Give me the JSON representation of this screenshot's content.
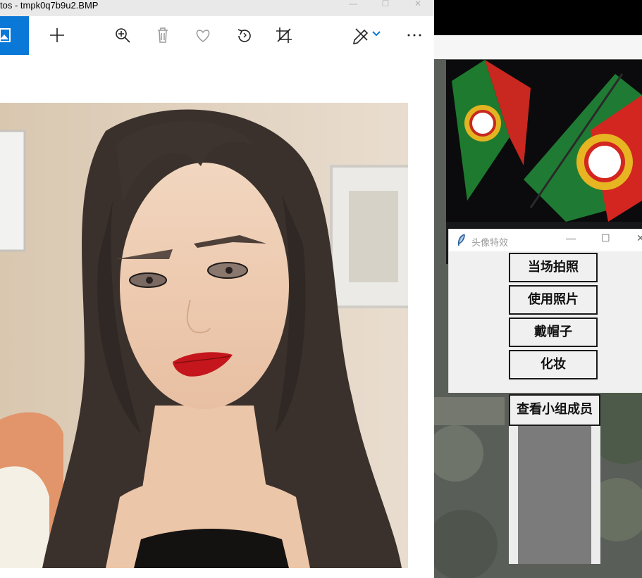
{
  "photos_window": {
    "title": "tos - tmpk0q7b9u2.BMP",
    "controls": {
      "minimize": "—",
      "maximize": "☐",
      "close": "✕"
    },
    "toolbar_icons": [
      "image-icon",
      "add-icon",
      "zoom-in-icon",
      "delete-icon",
      "favorite-icon",
      "rotate-icon",
      "crop-icon",
      "edit-draw-icon",
      "more-icon"
    ],
    "colors": {
      "accent": "#0a78d7",
      "toolbar_bg": "#ffffff",
      "titlebar_bg": "#e9e9e9"
    }
  },
  "effect_window": {
    "title": "头像特效",
    "controls": {
      "minimize": "—",
      "maximize": "☐",
      "close": "✕"
    },
    "buttons": [
      {
        "label": "当场拍照"
      },
      {
        "label": "使用照片"
      },
      {
        "label": "戴帽子"
      },
      {
        "label": "化妆"
      }
    ]
  },
  "members_button": {
    "label": "查看小组成员"
  }
}
